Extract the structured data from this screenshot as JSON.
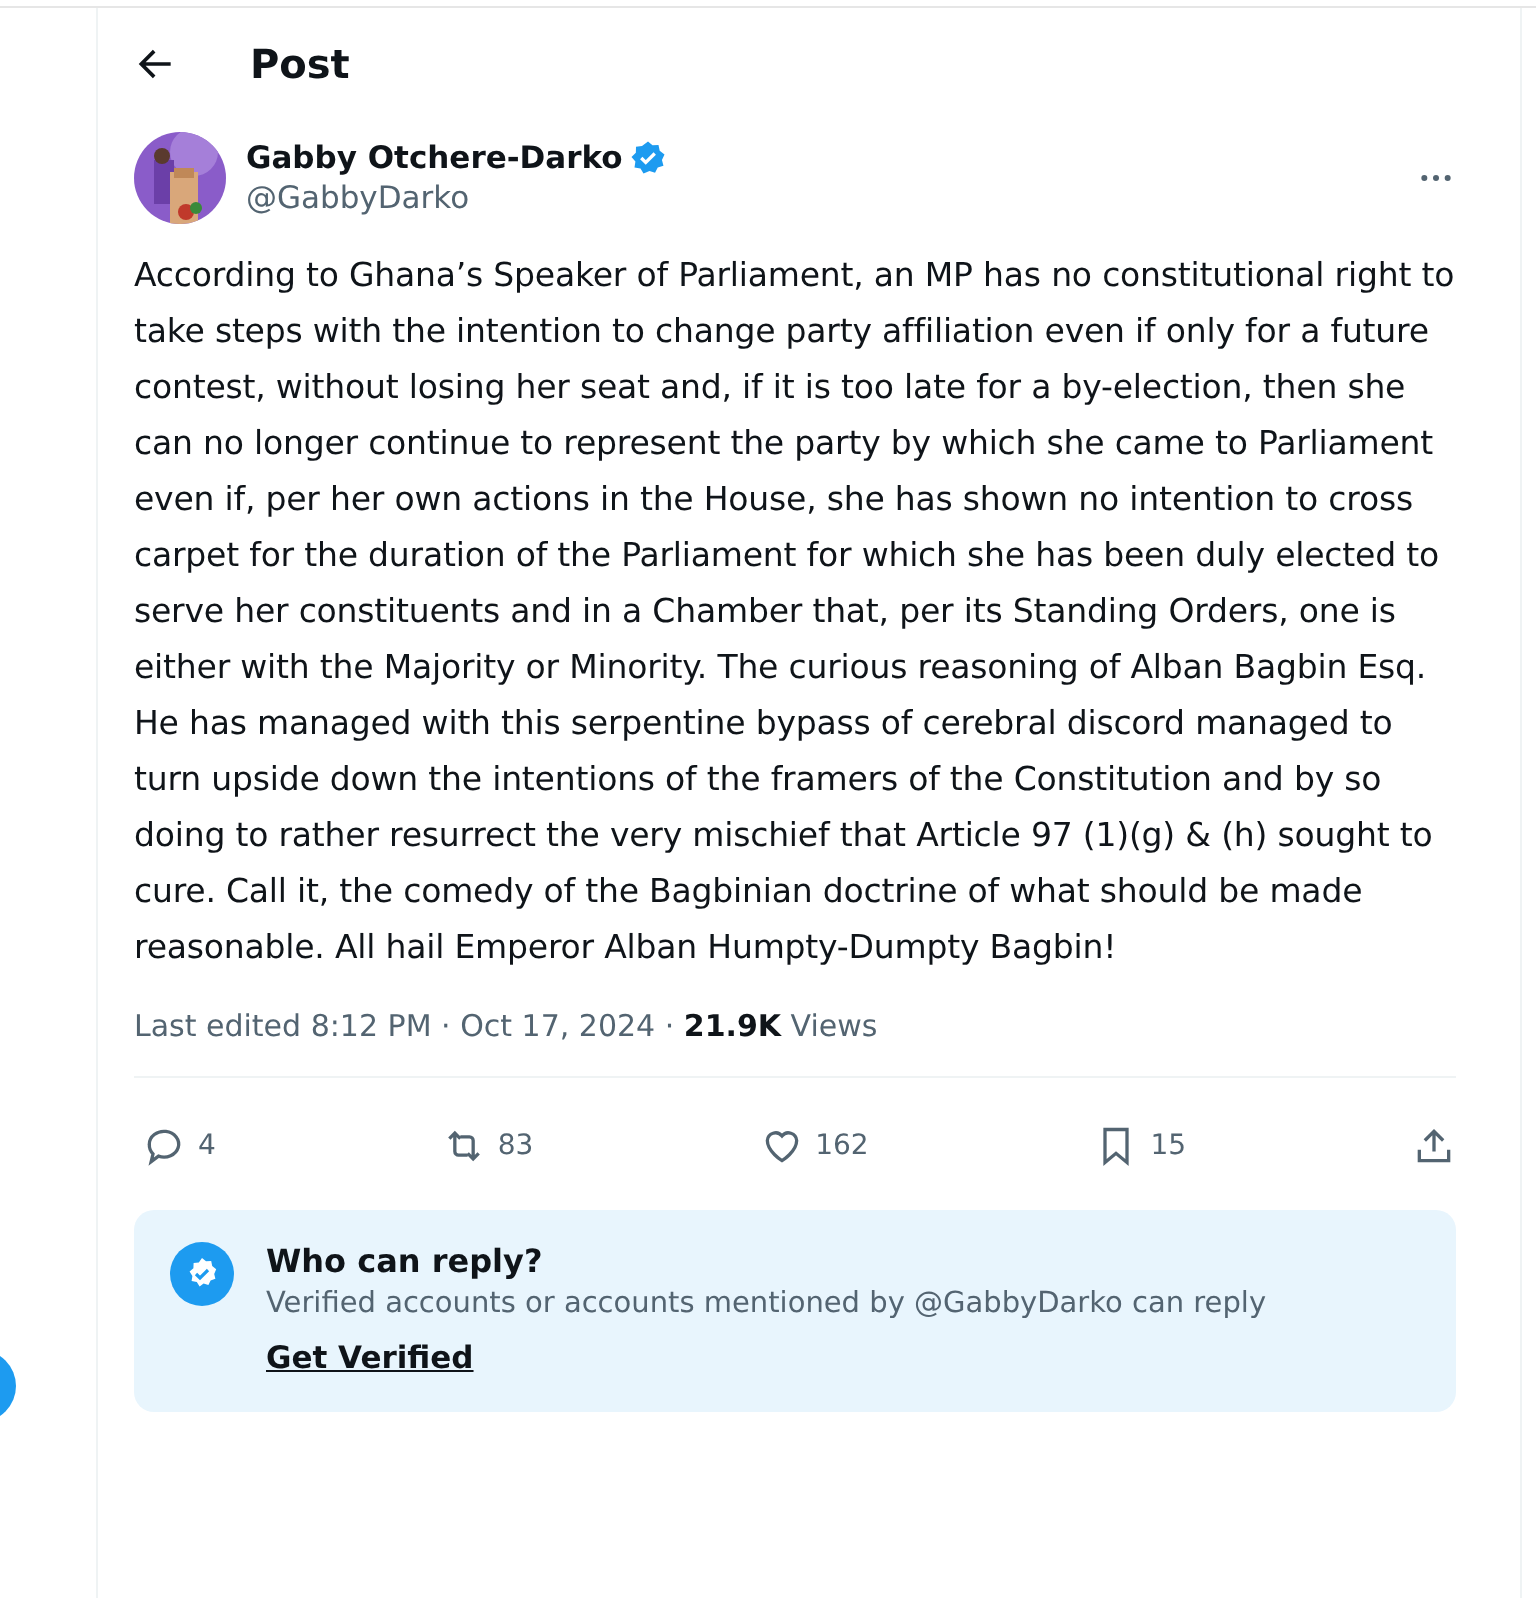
{
  "header": {
    "title": "Post"
  },
  "author": {
    "name": "Gabby Otchere-Darko",
    "handle": "@GabbyDarko",
    "verified": true
  },
  "post": {
    "text": "According to Ghana’s Speaker of Parliament, an MP has no constitutional right to take steps with the intention to change party affiliation even if only for a future contest, without losing her seat and, if it is too late for a by-election, then she can no longer continue to represent the party by which she came to Parliament even if, per her own actions in the House, she has shown no intention to cross carpet for the duration of the Parliament for which she has been duly elected to serve her constituents and in a Chamber that, per its Standing Orders, one is either with the Majority or Minority. The curious reasoning of Alban Bagbin Esq. He has managed with this serpentine bypass of cerebral discord managed to turn upside down the intentions of the framers of the Constitution and by so doing to rather resurrect the very mischief that Article 97 (1)(g) & (h) sought to cure. Call it, the comedy of the Bagbinian doctrine of what should be made reasonable. All hail Emperor Alban Humpty-Dumpty Bagbin!",
    "meta": "Last edited 8:12 PM · Oct 17, 2024 · **21.9K** Views"
  },
  "actions": [
    {
      "kind": "reply",
      "count": "4"
    },
    {
      "kind": "repost",
      "count": "83"
    },
    {
      "kind": "like",
      "count": "162"
    },
    {
      "kind": "bookmark",
      "count": "15"
    },
    {
      "kind": "share"
    }
  ],
  "reply_notice": {
    "title": "Who can reply?",
    "text": "Verified accounts or accounts mentioned by @GabbyDarko can reply",
    "link": "Get Verified"
  }
}
